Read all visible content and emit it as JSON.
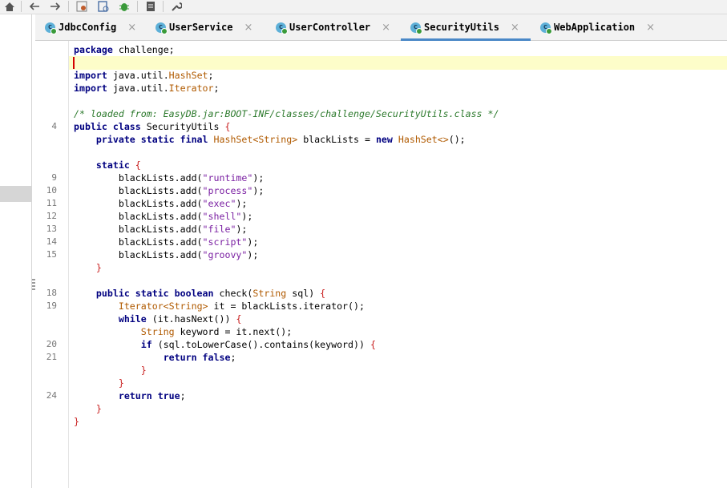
{
  "toolbar": {
    "items": [
      "home-icon",
      "back-arrow-icon",
      "forward-arrow-icon",
      "settings-icon",
      "bookmark-icon",
      "bug-icon",
      "file-icon",
      "wrench-icon"
    ]
  },
  "tabs": [
    {
      "label": "JdbcConfig",
      "icon": "class-icon",
      "active": false
    },
    {
      "label": "UserService",
      "icon": "class-icon",
      "active": false
    },
    {
      "label": "UserController",
      "icon": "class-icon",
      "active": false
    },
    {
      "label": "SecurityUtils",
      "icon": "class-icon",
      "active": true
    },
    {
      "label": "WebApplication",
      "icon": "class-icon",
      "active": false
    }
  ],
  "close_glyph": "×",
  "class_icon_letter": "c",
  "gutter_numbers": [
    {
      "row": 6,
      "num": "4"
    },
    {
      "row": 10,
      "num": "9"
    },
    {
      "row": 11,
      "num": "10"
    },
    {
      "row": 12,
      "num": "11"
    },
    {
      "row": 13,
      "num": "12"
    },
    {
      "row": 14,
      "num": "13"
    },
    {
      "row": 15,
      "num": "14"
    },
    {
      "row": 16,
      "num": "15"
    },
    {
      "row": 19,
      "num": "18"
    },
    {
      "row": 20,
      "num": "19"
    },
    {
      "row": 23,
      "num": "20"
    },
    {
      "row": 24,
      "num": "21"
    },
    {
      "row": 27,
      "num": "24"
    }
  ],
  "code_lines": [
    [
      {
        "t": "kw",
        "s": "package"
      },
      {
        "t": "",
        "s": " challenge;"
      }
    ],
    [],
    [
      {
        "t": "kw",
        "s": "import"
      },
      {
        "t": "",
        "s": " java.util."
      },
      {
        "t": "ty",
        "s": "HashSet"
      },
      {
        "t": "",
        "s": ";"
      }
    ],
    [
      {
        "t": "kw",
        "s": "import"
      },
      {
        "t": "",
        "s": " java.util."
      },
      {
        "t": "ty",
        "s": "Iterator"
      },
      {
        "t": "",
        "s": ";"
      }
    ],
    [],
    [
      {
        "t": "cm",
        "s": "/* loaded from: EasyDB.jar:BOOT-INF/classes/challenge/SecurityUtils.class */"
      }
    ],
    [
      {
        "t": "kw",
        "s": "public class"
      },
      {
        "t": "",
        "s": " SecurityUtils "
      },
      {
        "t": "br",
        "s": "{"
      }
    ],
    [
      {
        "t": "",
        "s": "    "
      },
      {
        "t": "kw",
        "s": "private static final"
      },
      {
        "t": "",
        "s": " "
      },
      {
        "t": "ty",
        "s": "HashSet<String>"
      },
      {
        "t": "",
        "s": " blackLists = "
      },
      {
        "t": "kw",
        "s": "new"
      },
      {
        "t": "",
        "s": " "
      },
      {
        "t": "ty",
        "s": "HashSet<>"
      },
      {
        "t": "",
        "s": "();"
      }
    ],
    [],
    [
      {
        "t": "",
        "s": "    "
      },
      {
        "t": "kw",
        "s": "static"
      },
      {
        "t": "",
        "s": " "
      },
      {
        "t": "br",
        "s": "{"
      }
    ],
    [
      {
        "t": "",
        "s": "        blackLists.add("
      },
      {
        "t": "st",
        "s": "\"runtime\""
      },
      {
        "t": "",
        "s": ");"
      }
    ],
    [
      {
        "t": "",
        "s": "        blackLists.add("
      },
      {
        "t": "st",
        "s": "\"process\""
      },
      {
        "t": "",
        "s": ");"
      }
    ],
    [
      {
        "t": "",
        "s": "        blackLists.add("
      },
      {
        "t": "st",
        "s": "\"exec\""
      },
      {
        "t": "",
        "s": ");"
      }
    ],
    [
      {
        "t": "",
        "s": "        blackLists.add("
      },
      {
        "t": "st",
        "s": "\"shell\""
      },
      {
        "t": "",
        "s": ");"
      }
    ],
    [
      {
        "t": "",
        "s": "        blackLists.add("
      },
      {
        "t": "st",
        "s": "\"file\""
      },
      {
        "t": "",
        "s": ");"
      }
    ],
    [
      {
        "t": "",
        "s": "        blackLists.add("
      },
      {
        "t": "st",
        "s": "\"script\""
      },
      {
        "t": "",
        "s": ");"
      }
    ],
    [
      {
        "t": "",
        "s": "        blackLists.add("
      },
      {
        "t": "st",
        "s": "\"groovy\""
      },
      {
        "t": "",
        "s": ");"
      }
    ],
    [
      {
        "t": "",
        "s": "    "
      },
      {
        "t": "br",
        "s": "}"
      }
    ],
    [],
    [
      {
        "t": "",
        "s": "    "
      },
      {
        "t": "kw",
        "s": "public static boolean"
      },
      {
        "t": "",
        "s": " check("
      },
      {
        "t": "ty",
        "s": "String"
      },
      {
        "t": "",
        "s": " sql) "
      },
      {
        "t": "br",
        "s": "{"
      }
    ],
    [
      {
        "t": "",
        "s": "        "
      },
      {
        "t": "ty",
        "s": "Iterator<String>"
      },
      {
        "t": "",
        "s": " it = blackLists.iterator();"
      }
    ],
    [
      {
        "t": "",
        "s": "        "
      },
      {
        "t": "kw",
        "s": "while"
      },
      {
        "t": "",
        "s": " (it.hasNext()) "
      },
      {
        "t": "br",
        "s": "{"
      }
    ],
    [
      {
        "t": "",
        "s": "            "
      },
      {
        "t": "ty",
        "s": "String"
      },
      {
        "t": "",
        "s": " keyword = it.next();"
      }
    ],
    [
      {
        "t": "",
        "s": "            "
      },
      {
        "t": "kw",
        "s": "if"
      },
      {
        "t": "",
        "s": " (sql.toLowerCase().contains(keyword)) "
      },
      {
        "t": "br",
        "s": "{"
      }
    ],
    [
      {
        "t": "",
        "s": "                "
      },
      {
        "t": "kw",
        "s": "return false"
      },
      {
        "t": "",
        "s": ";"
      }
    ],
    [
      {
        "t": "",
        "s": "            "
      },
      {
        "t": "br",
        "s": "}"
      }
    ],
    [
      {
        "t": "",
        "s": "        "
      },
      {
        "t": "br",
        "s": "}"
      }
    ],
    [
      {
        "t": "",
        "s": "        "
      },
      {
        "t": "kw",
        "s": "return true"
      },
      {
        "t": "",
        "s": ";"
      }
    ],
    [
      {
        "t": "",
        "s": "    "
      },
      {
        "t": "br",
        "s": "}"
      }
    ],
    [
      {
        "t": "br",
        "s": "}"
      }
    ]
  ],
  "colors": {
    "keyword": "#000080",
    "type": "#b05a00",
    "string": "#7a1fa2",
    "comment": "#2d7a2d",
    "brace": "#c81e1e",
    "active_tab_underline": "#4a88c7",
    "current_line_highlight": "#fdfdc9"
  }
}
